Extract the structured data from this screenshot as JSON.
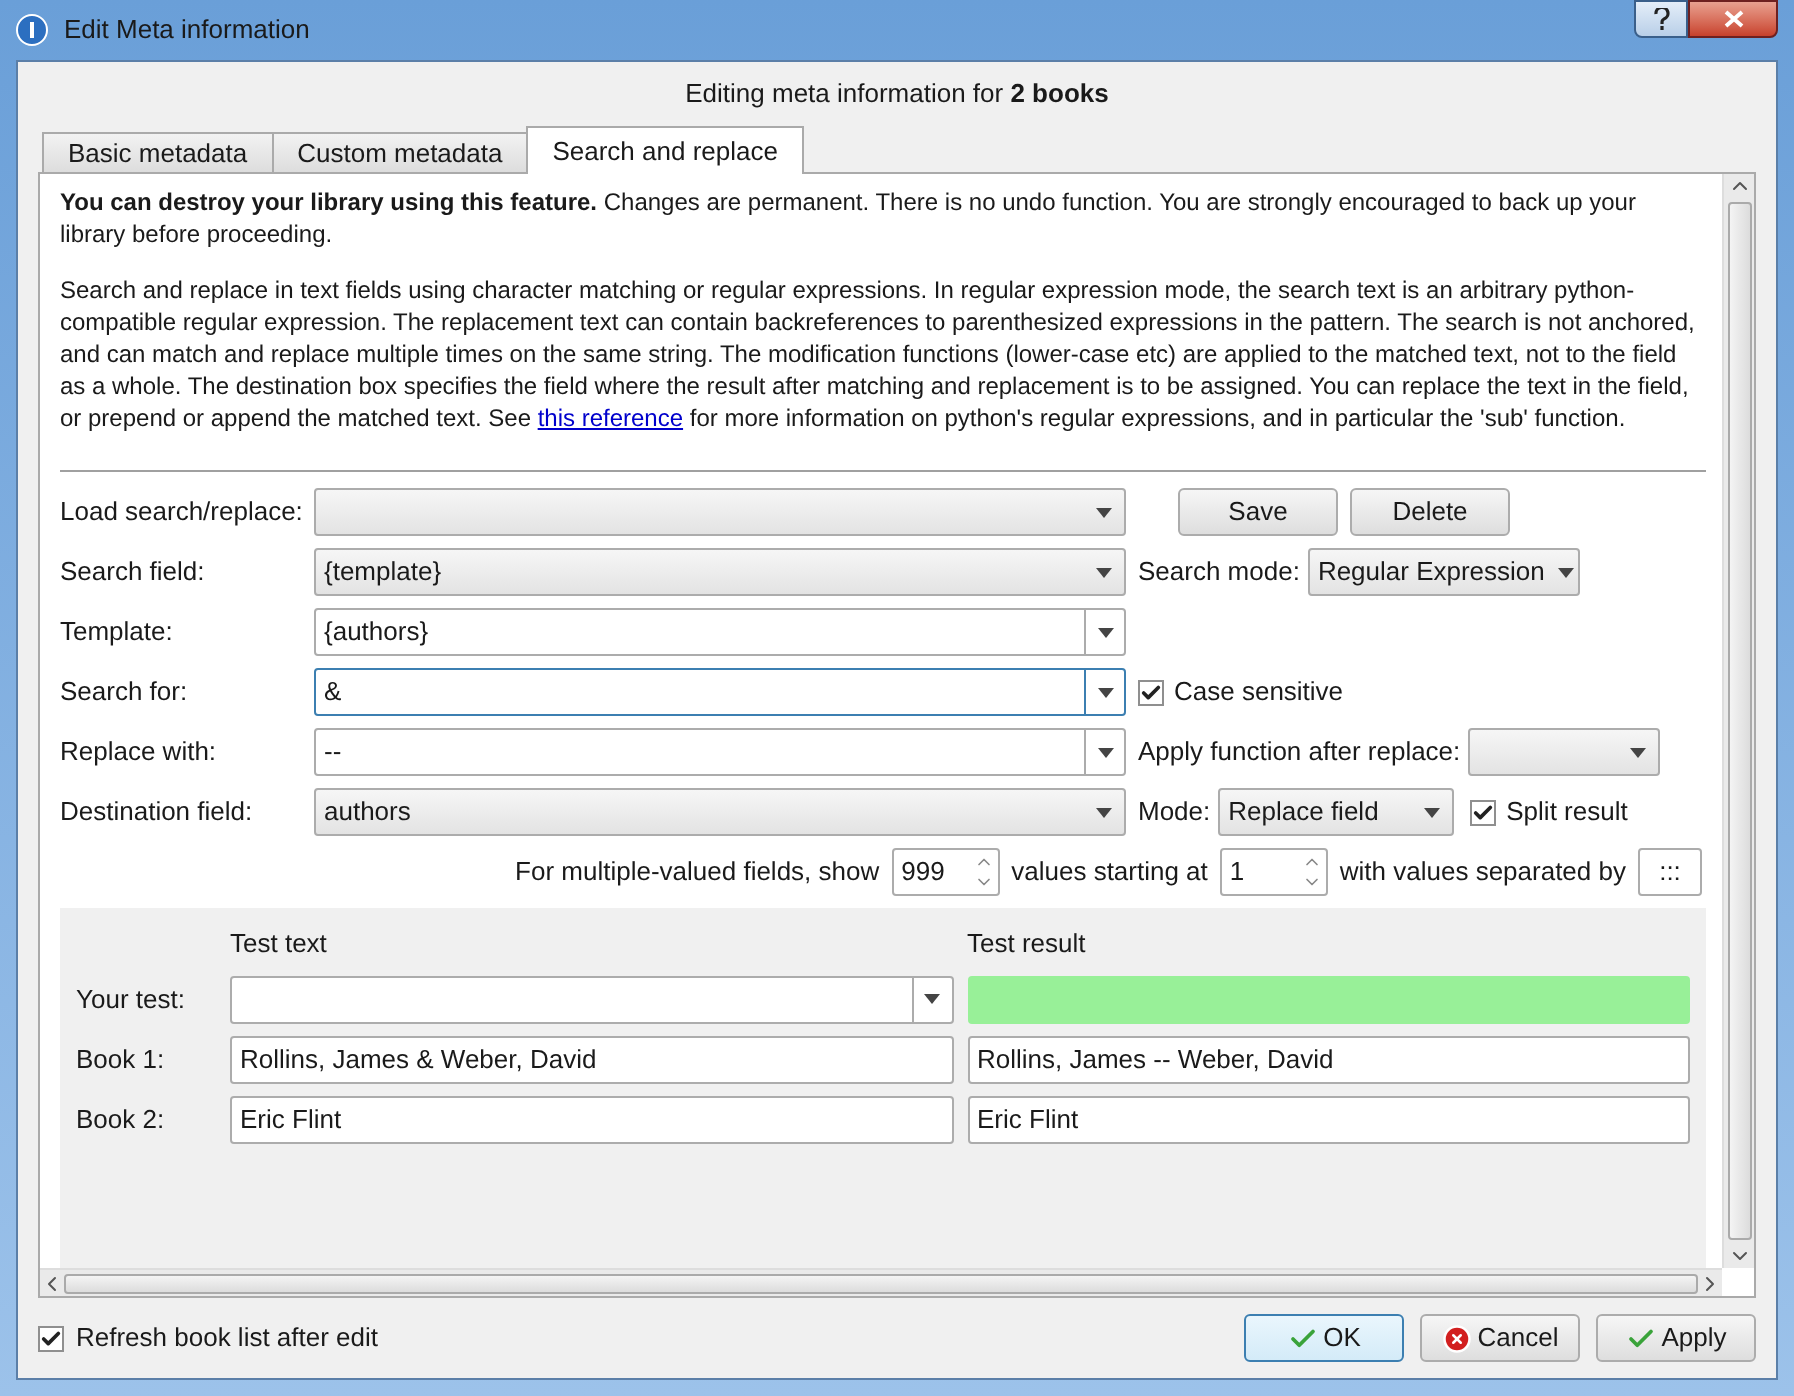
{
  "window": {
    "title": "Edit Meta information"
  },
  "heading": "Editing meta information for **2 books**",
  "tabs": [
    {
      "label": "Basic metadata",
      "selected": false
    },
    {
      "label": "Custom metadata",
      "selected": false
    },
    {
      "label": "Search and replace",
      "selected": true
    }
  ],
  "warning": "**You can destroy your library using this feature.** Changes are permanent. There is no undo function. You are strongly encouraged to back up your library before proceeding.",
  "description": {
    "before": "Search and replace in text fields using character matching or regular expressions. In regular expression mode, the search text is an arbitrary python-compatible regular expression. The replacement text can contain backreferences to parenthesized expressions in the pattern. The search is not anchored, and can match and replace multiple times on the same string. The modification functions (lower-case etc) are applied to the matched text, not to the field as a whole. The destination box specifies the field where the result after matching and replacement is to be assigned. You can replace the text in the field, or prepend or append the matched text. See ",
    "link": "this reference",
    "after": " for more information on python's regular expressions, and in particular the 'sub' function."
  },
  "load": {
    "label": "Load search/replace:",
    "save": "Save",
    "delete": "Delete"
  },
  "search_field": {
    "label": "Search field:",
    "value": "{template}",
    "mode_label": "Search mode:",
    "mode_value": "Regular Expression"
  },
  "template": {
    "label": "Template:",
    "value": "{authors}"
  },
  "search_for": {
    "label": "Search for:",
    "value": "&",
    "focused": true,
    "case_label": "Case sensitive",
    "case_checked": true
  },
  "replace_with": {
    "label": "Replace with:",
    "value": "--",
    "function_label": "Apply function after replace:"
  },
  "destination": {
    "label": "Destination field:",
    "value": "authors",
    "mode_label": "Mode:",
    "mode_value": "Replace field",
    "split_label": "Split result",
    "split_checked": true
  },
  "multi": {
    "show_label": "For multiple-valued fields, show",
    "show_value": "999",
    "start_label": "values starting at",
    "start_value": "1",
    "sep_label": "with values separated by",
    "sep_value": ":::"
  },
  "test": {
    "text_header": "Test text",
    "result_header": "Test result",
    "your_test_label": "Your test:",
    "books": [
      {
        "label": "Book 1:",
        "text": "Rollins, James & Weber, David",
        "result": "Rollins, James -- Weber, David"
      },
      {
        "label": "Book 2:",
        "text": "Eric Flint",
        "result": "Eric Flint"
      }
    ]
  },
  "footer": {
    "refresh_label": "Refresh book list after edit",
    "refresh_checked": true,
    "buttons": [
      {
        "label": "OK",
        "kind": "ok",
        "focused": true
      },
      {
        "label": "Cancel",
        "kind": "cancel",
        "focused": false
      },
      {
        "label": "Apply",
        "kind": "apply",
        "focused": false
      }
    ]
  }
}
